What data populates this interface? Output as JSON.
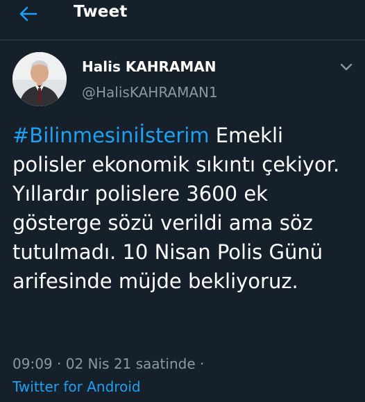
{
  "header": {
    "title": "Tweet",
    "back_icon": "back-arrow-icon"
  },
  "tweet": {
    "author": {
      "display_name": "Halis KAHRAMAN",
      "handle": "@HalisKAHRAMAN1"
    },
    "menu_icon": "chevron-down-icon",
    "hashtag": "#Bilinmesiniİsterim",
    "text": " Emekli polisler ekonomik sıkıntı çekiyor. Yıllardır polislere 3600 ek gösterge sözü verildi ama söz tutulmadı. 10 Nisan Polis Günü arifesinde müjde bekliyoruz.",
    "time": "09:09",
    "date": "02 Nis 21 saatinde",
    "separator": "·",
    "source": "Twitter for Android"
  },
  "colors": {
    "background": "#15202b",
    "accent": "#1da1f2",
    "secondary_text": "#8899a6",
    "divider": "#38444d"
  }
}
